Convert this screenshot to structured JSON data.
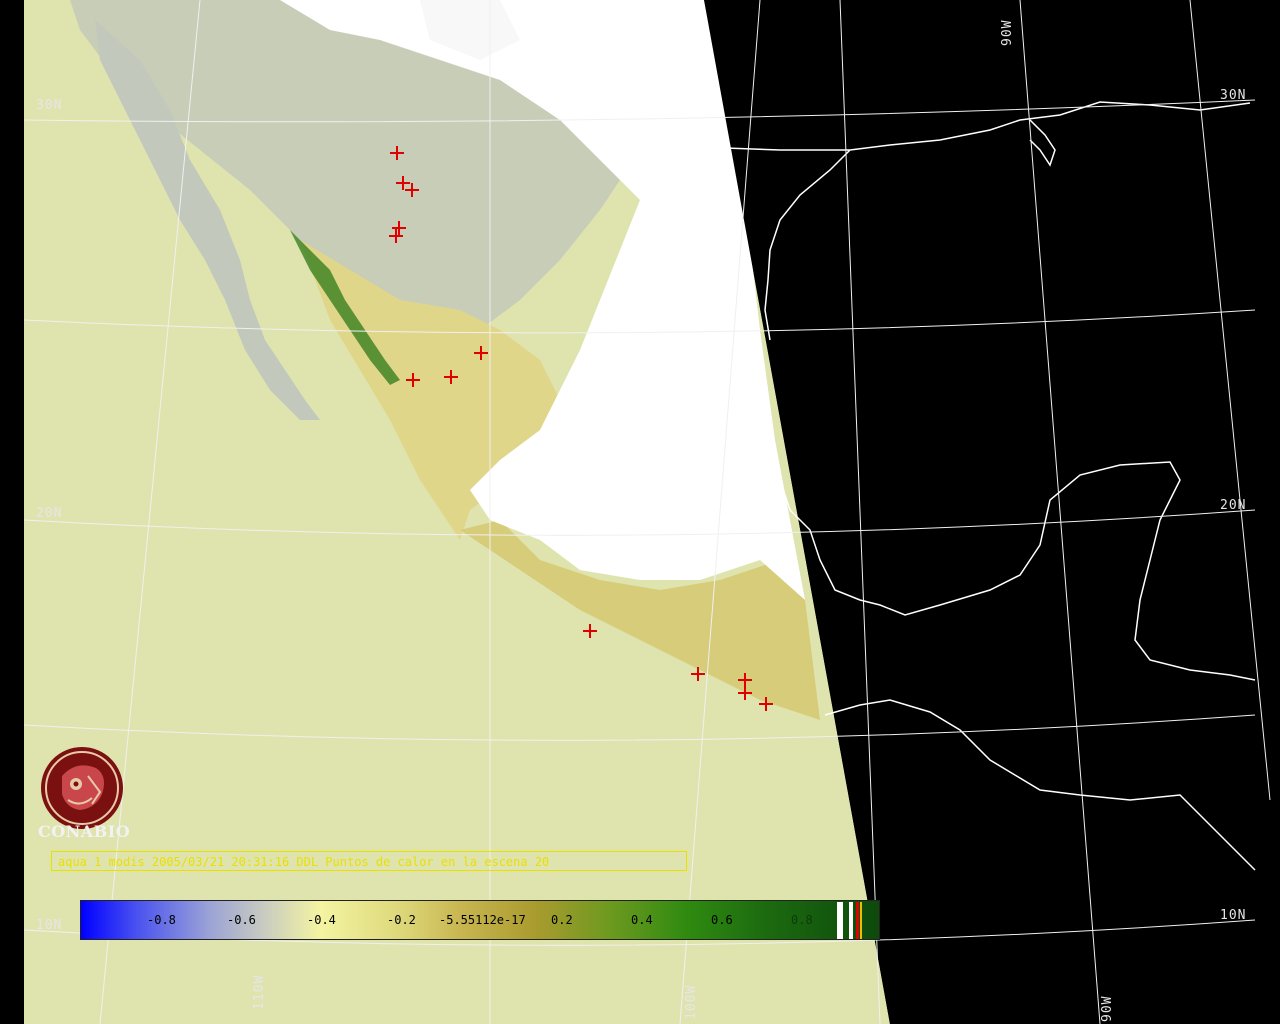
{
  "map": {
    "graticule_labels": {
      "lat_30n_left": "30N",
      "lat_30n_right": "30N",
      "lat_20n_left": "20N",
      "lat_20n_right": "20N",
      "lat_10n_left": "10N",
      "lat_10n_right": "10N",
      "lon_90w_top": "90W",
      "lon_90w_bottom": "90W",
      "lon_100w_bottom": "100W",
      "lon_110w_bottom": "110W"
    },
    "caption": "aqua 1 modis 2005/03/21 20:31:16 DDL  Puntos de calor en la escena 20",
    "colorbar_ticks": [
      "-0.8",
      "-0.6",
      "-0.4",
      "-0.2",
      "-5.55112e-17",
      "0.2",
      "0.4",
      "0.6",
      "0.8"
    ],
    "colors": {
      "ocean": "#dfe4ae",
      "night": "#000000",
      "cloud": "#ffffff",
      "grid": "#f0f0f0",
      "hotspot": "#e00000",
      "caption": "#e8e000",
      "logo": "#7a1010"
    }
  },
  "logo": {
    "text": "CONABIO",
    "icon": "conabio-logo-icon"
  }
}
